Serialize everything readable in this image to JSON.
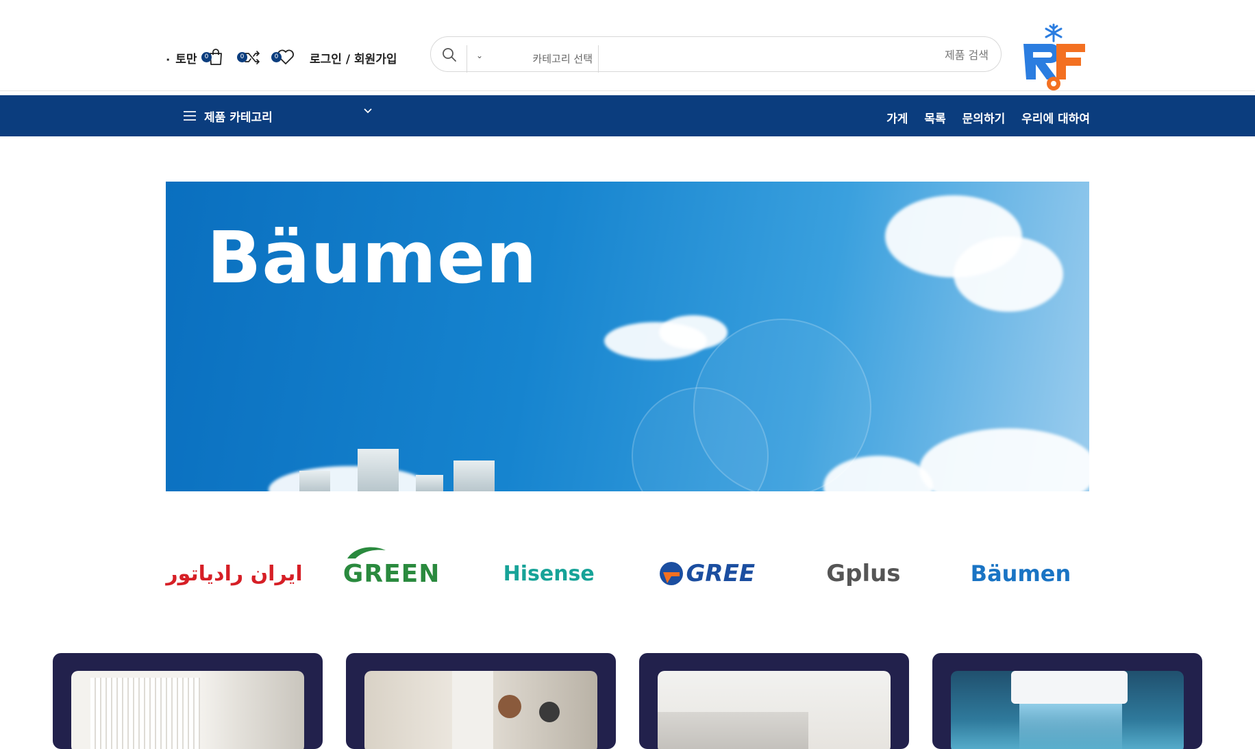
{
  "header": {
    "search_placeholder": "제품 검색",
    "category_select_label": "카테고리 선택",
    "login_label": "로그인 / 회원가입",
    "wishlist_count": "0",
    "compare_count": "0",
    "cart_count": "0",
    "cart_total": "۰ 토만",
    "logo_text": "RF"
  },
  "navbar": {
    "categories_label": "제품 카테고리",
    "links": [
      "우리에 대하여",
      "문의하기",
      "목록",
      "가게"
    ]
  },
  "banner": {
    "brand": "Bäumen"
  },
  "brands": {
    "items": [
      "ایران رادیاتور",
      "GREEN",
      "Hisense",
      "GREE",
      "Gplus",
      "Bäumen"
    ],
    "colors": {
      "iran_radiator": "#d61f26",
      "green": "#2a8a3e",
      "hisense": "#17a398",
      "gree": "#1b4ea0",
      "gplus": "#555555",
      "baumen": "#1a74c4"
    }
  },
  "colors": {
    "navbar": "#0b3d7e",
    "card_bg": "#22214c",
    "accent_orange": "#f37021"
  }
}
